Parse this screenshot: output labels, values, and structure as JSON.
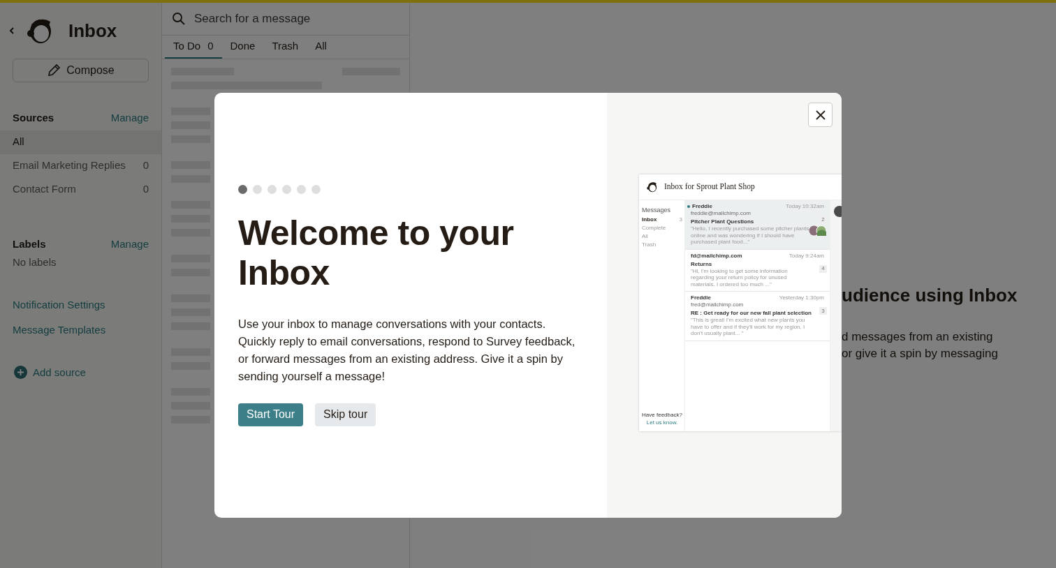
{
  "sidebar": {
    "title": "Inbox",
    "compose": "Compose",
    "sources": {
      "heading": "Sources",
      "manage": "Manage",
      "items": [
        {
          "label": "All",
          "selected": true
        },
        {
          "label": "Email Marketing Replies",
          "count": "0",
          "selected": false
        },
        {
          "label": "Contact Form",
          "count": "0",
          "selected": false
        }
      ]
    },
    "labels": {
      "heading": "Labels",
      "manage": "Manage",
      "empty": "No labels"
    },
    "links": [
      "Notification Settings",
      "Message Templates"
    ],
    "add_source": "Add source"
  },
  "message_list": {
    "search": {
      "placeholder": "Search for a message"
    },
    "tabs": [
      {
        "label": "To Do",
        "count": "0",
        "selected": true
      },
      {
        "label": "Done",
        "selected": false
      },
      {
        "label": "Trash",
        "selected": false
      },
      {
        "label": "All",
        "selected": false
      }
    ]
  },
  "main": {
    "heading": "udience using Inbox",
    "body_lines": [
      "d messages from an existing",
      "or give it a spin by messaging"
    ]
  },
  "modal": {
    "steps": [
      {
        "selected": true
      },
      {
        "selected": false
      },
      {
        "selected": false
      },
      {
        "selected": false
      },
      {
        "selected": false
      },
      {
        "selected": false
      }
    ],
    "title": "Welcome to your Inbox",
    "description": "Use your inbox to manage conversations with your contacts. Quickly reply to email conversations, respond to Survey feedback, or forward messages from an existing address. Give it a spin by sending yourself a message!",
    "buttons": [
      {
        "label": "Start Tour",
        "kind": "primary"
      },
      {
        "label": "Skip tour",
        "kind": "secondary"
      }
    ],
    "preview": {
      "title": "Inbox for Sprout Plant Shop",
      "nav_heading": "Messages",
      "nav": [
        {
          "label": "Inbox",
          "count": "3",
          "selected": true
        },
        {
          "label": "Complete",
          "selected": false
        },
        {
          "label": "All",
          "selected": false
        },
        {
          "label": "Trash",
          "selected": false
        }
      ],
      "messages": [
        {
          "sender": "Freddie",
          "email": "freddie@mailchimp.com",
          "time": "Today 10:32am",
          "subject": "Pitcher Plant Questions",
          "snippet": "\"Hello, I recently purchased some pitcher plants online and was wondering if I should have purchased plant food...\"",
          "count": "2",
          "unread": true,
          "selected": true,
          "avatars": true
        },
        {
          "sender": "fd@mailchimp.com",
          "time": "Today 9:24am",
          "subject": "Returns",
          "snippet": "\"Hi, I'm looking to get some information regarding your return policy for unused materials. I ordered too much ...\"",
          "count": "4",
          "unread": false,
          "selected": false,
          "avatars": false
        },
        {
          "sender": "Freddie",
          "email": "fred@mailchimp.com",
          "time": "Yesterday 1:30pm",
          "subject": "RE : Get ready for our new fall plant selection",
          "snippet": "\"This is great! I'm excited what new plants you have to offer and if they'll work for my region. I don't usually plant... \"",
          "count": "3",
          "unread": false,
          "selected": false,
          "avatars": false
        }
      ],
      "feedback": "Have feedback?",
      "feedback_link": "Let us know."
    }
  }
}
